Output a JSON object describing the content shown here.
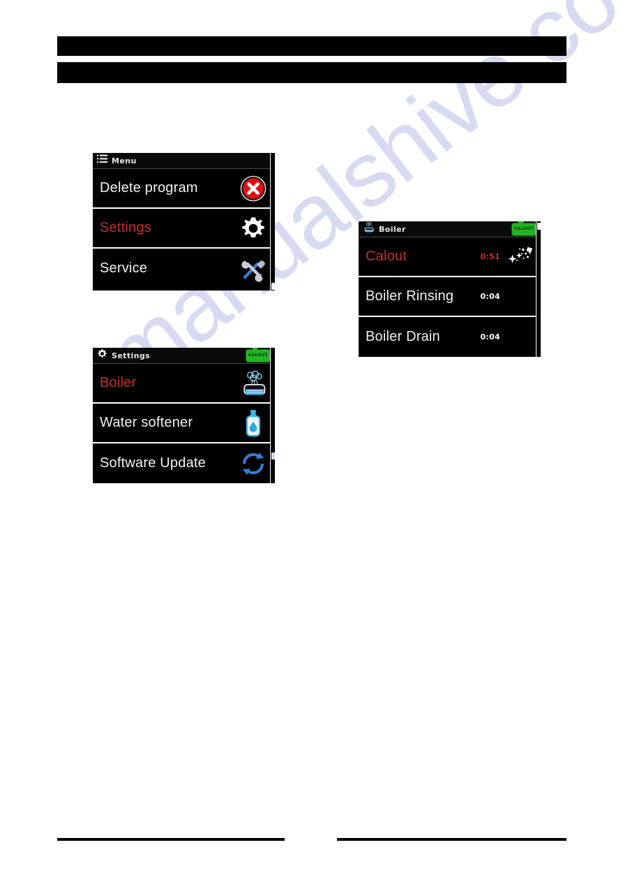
{
  "page": {
    "watermark_text": "manualshive.com",
    "background_color": "#ffffff"
  },
  "header_bars": [
    {
      "name": "header-bar-1",
      "text": "",
      "redacted": true,
      "color": "#000000"
    },
    {
      "name": "header-bar-2",
      "text": "",
      "redacted": true,
      "color": "#000000"
    }
  ],
  "footer_rules": [
    {
      "name": "footer-rule-left",
      "color": "#000000"
    },
    {
      "name": "footer-rule-right",
      "color": "#000000"
    }
  ],
  "colors": {
    "screen_background": "#000000",
    "text_primary": "#f2f2f2",
    "text_highlight_red": "#c0302a",
    "badge_green": "#22b422",
    "icon_blue": "#2ea8e0",
    "divider": "#ffffff"
  },
  "screens": {
    "menu": {
      "title": "Menu",
      "title_icon": "hamburger-menu-icon",
      "badge": null,
      "rows": [
        {
          "label": "Delete program",
          "highlighted": false,
          "time": "",
          "icon": "delete-circle-x-icon"
        },
        {
          "label": "Settings",
          "highlighted": true,
          "time": "",
          "icon": "gear-icon"
        },
        {
          "label": "Service",
          "highlighted": false,
          "time": "",
          "icon": "wrench-hammer-icon"
        }
      ]
    },
    "settings": {
      "title": "Settings",
      "title_icon": "gear-icon",
      "badge": "CALOUT",
      "rows": [
        {
          "label": "Boiler",
          "highlighted": true,
          "time": "",
          "icon": "boiler-steam-icon"
        },
        {
          "label": "Water softener",
          "highlighted": false,
          "time": "",
          "icon": "water-bottle-drop-icon"
        },
        {
          "label": "Software Update",
          "highlighted": false,
          "time": "",
          "icon": "refresh-arrows-icon"
        }
      ]
    },
    "boiler": {
      "title": "Boiler",
      "title_icon": "boiler-steam-icon",
      "badge": "CALOUT",
      "rows": [
        {
          "label": "Calout",
          "highlighted": true,
          "time": "0:51",
          "icon": "sparkle-descale-icon"
        },
        {
          "label": "Boiler Rinsing",
          "highlighted": false,
          "time": "0:04",
          "icon": ""
        },
        {
          "label": "Boiler Drain",
          "highlighted": false,
          "time": "0:04",
          "icon": ""
        }
      ]
    }
  }
}
